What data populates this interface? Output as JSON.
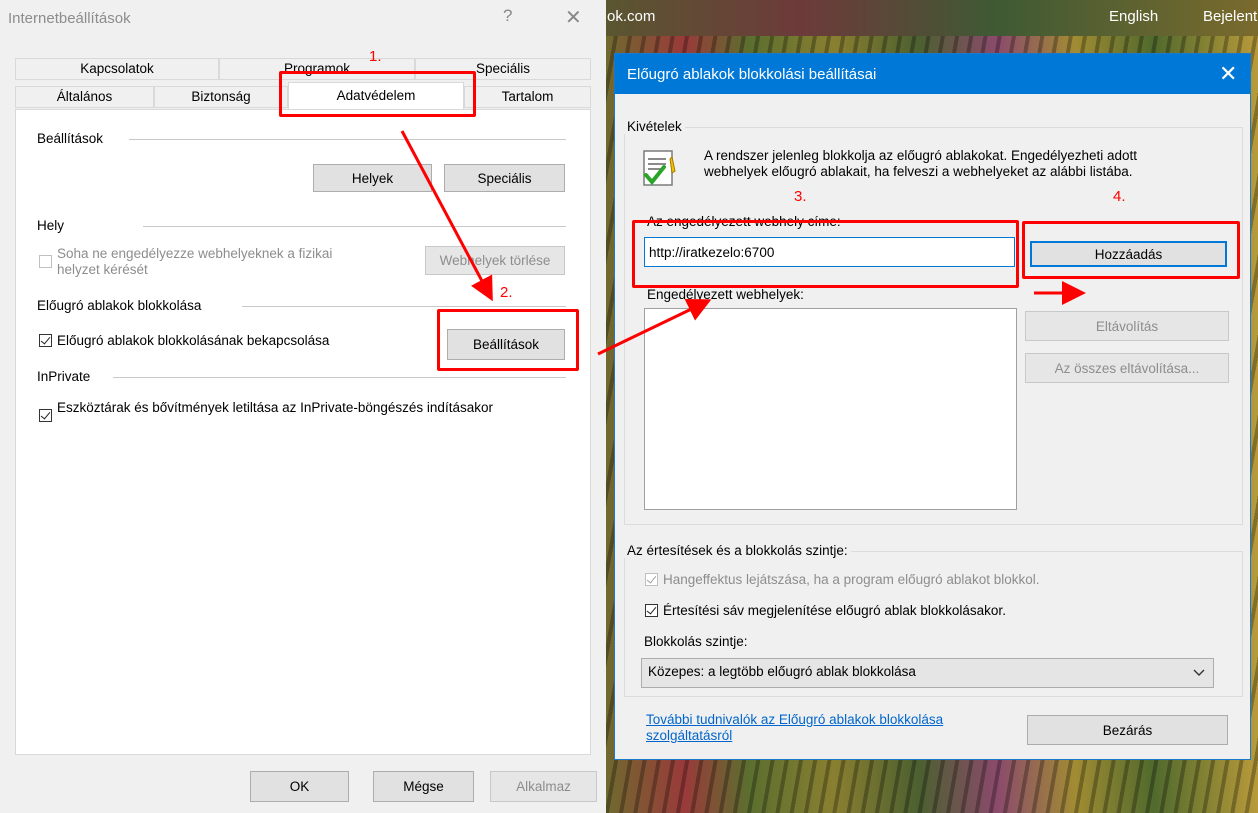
{
  "background": {
    "url_fragment": "ok.com",
    "lang_link": "English",
    "login_link": "Bejelentkezés"
  },
  "internet_options": {
    "title": "Internetbeállítások",
    "help_glyph": "?",
    "close_glyph": "✕",
    "tabs_top": [
      "Kapcsolatok",
      "Programok",
      "Speciális"
    ],
    "tabs_bottom": [
      "Általános",
      "Biztonság",
      "Adatvédelem",
      "Tartalom"
    ],
    "settings_header": "Beállítások",
    "btn_sites": "Helyek",
    "btn_advanced": "Speciális",
    "location_header": "Hely",
    "location_checkbox_label": "Soha ne engedélyezze webhelyeknek a fizikai helyzet kérését",
    "btn_clear_sites": "Webhelyek törlése",
    "popup_header": "Előugró ablakok blokkolása",
    "popup_checkbox_label": "Előugró ablakok blokkolásának bekapcsolása",
    "btn_popup_settings": "Beállítások",
    "inprivate_header": "InPrivate",
    "inprivate_checkbox_label": "Eszköztárak és bővítmények letiltása az InPrivate-böngészés indításakor",
    "btn_ok": "OK",
    "btn_cancel": "Mégse",
    "btn_apply": "Alkalmaz"
  },
  "popup_blocker": {
    "title": "Előugró ablakok blokkolási beállításai",
    "close_glyph": "✕",
    "exceptions_header": "Kivételek",
    "info_text": "A rendszer jelenleg blokkolja az előugró ablakokat. Engedélyezheti adott webhelyek előugró ablakait, ha felveszi a webhelyeket az alábbi listába.",
    "address_label": "Az engedélyezett webhely címe:",
    "address_value": "http://iratkezelo:6700",
    "btn_add": "Hozzáadás",
    "allowed_label": "Engedélyezett webhelyek:",
    "btn_remove": "Eltávolítás",
    "btn_remove_all": "Az összes eltávolítása...",
    "notif_header": "Az értesítések és a blokkolás szintje:",
    "sound_checkbox_label": "Hangeffektus lejátszása, ha a program előugró ablakot blokkol.",
    "bar_checkbox_label": "Értesítési sáv megjelenítése előugró ablak blokkolásakor.",
    "level_label": "Blokkolás szintje:",
    "level_value": "Közepes: a legtöbb előugró ablak blokkolása",
    "learn_more_link": "További tudnivalók az Előugró ablakok blokkolása szolgáltatásról",
    "btn_close": "Bezárás"
  },
  "annotations": {
    "step1": "1.",
    "step2": "2.",
    "step3": "3.",
    "step4": "4.",
    "color": "#ff0000"
  },
  "colors": {
    "accent": "#0078d7",
    "dialog_bg": "#f0f0f0",
    "link": "#0066cc"
  },
  "icons": {
    "info_icon": "document-checkmark-icon",
    "dropdown_icon": "chevron-down-icon"
  }
}
